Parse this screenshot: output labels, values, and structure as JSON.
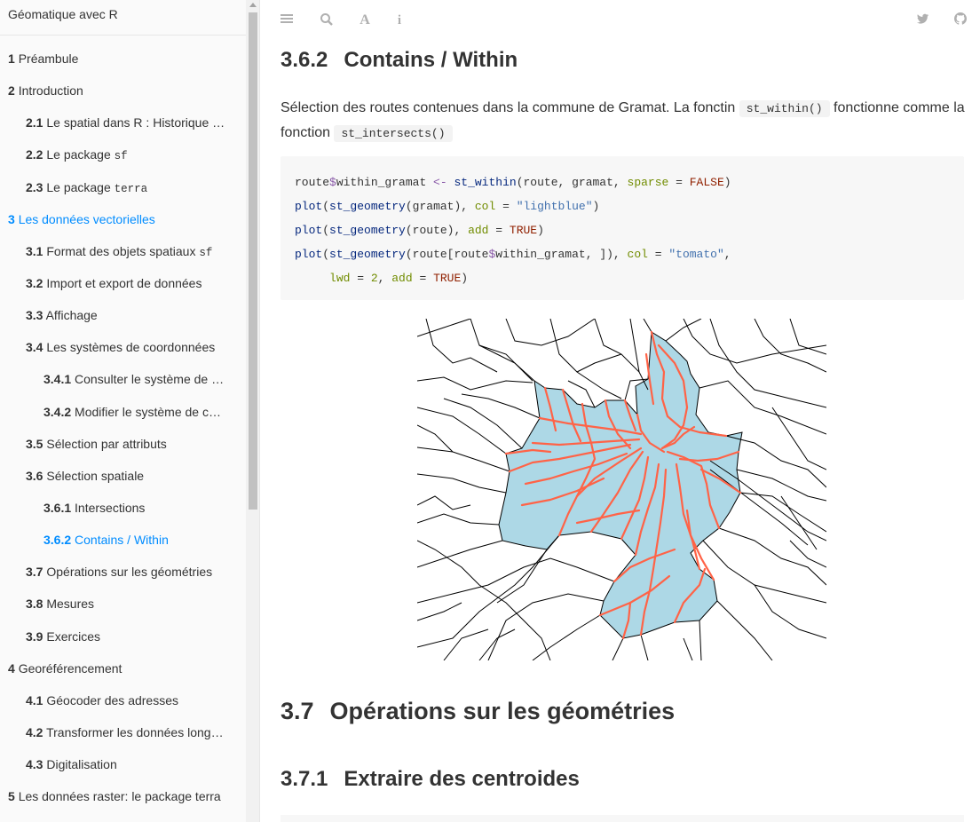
{
  "sidebar": {
    "title": "Géomatique avec R",
    "items": [
      {
        "num": "1",
        "label": "Préambule",
        "level": 1
      },
      {
        "num": "2",
        "label": "Introduction",
        "level": 1
      },
      {
        "num": "2.1",
        "label": "Le spatial dans R : Historique …",
        "level": 2
      },
      {
        "num": "2.2",
        "label": "Le package ",
        "code": "sf",
        "level": 2
      },
      {
        "num": "2.3",
        "label": "Le package ",
        "code": "terra",
        "level": 2
      },
      {
        "num": "3",
        "label": "Les données vectorielles",
        "level": 1,
        "active": true
      },
      {
        "num": "3.1",
        "label": "Format des objets spatiaux ",
        "code": "sf",
        "level": 2
      },
      {
        "num": "3.2",
        "label": "Import et export de données",
        "level": 2
      },
      {
        "num": "3.3",
        "label": "Affichage",
        "level": 2
      },
      {
        "num": "3.4",
        "label": "Les systèmes de coordonnées",
        "level": 2
      },
      {
        "num": "3.4.1",
        "label": "Consulter le système de …",
        "level": 3
      },
      {
        "num": "3.4.2",
        "label": "Modifier le système de c…",
        "level": 3
      },
      {
        "num": "3.5",
        "label": "Sélection par attributs",
        "level": 2
      },
      {
        "num": "3.6",
        "label": "Sélection spatiale",
        "level": 2
      },
      {
        "num": "3.6.1",
        "label": "Intersections",
        "level": 3
      },
      {
        "num": "3.6.2",
        "label": "Contains / Within",
        "level": 3,
        "active": true
      },
      {
        "num": "3.7",
        "label": "Opérations sur les géométries",
        "level": 2
      },
      {
        "num": "3.8",
        "label": "Mesures",
        "level": 2
      },
      {
        "num": "3.9",
        "label": "Exercices",
        "level": 2
      },
      {
        "num": "4",
        "label": "Georéférencement",
        "level": 1
      },
      {
        "num": "4.1",
        "label": "Géocoder des adresses",
        "level": 2
      },
      {
        "num": "4.2",
        "label": "Transformer les données long…",
        "level": 2
      },
      {
        "num": "4.3",
        "label": "Digitalisation",
        "level": 2
      },
      {
        "num": "5",
        "label": "Les données raster: le package terra",
        "level": 1
      }
    ]
  },
  "header": {
    "icons": [
      "menu-icon",
      "search-icon",
      "font-icon",
      "info-icon",
      "twitter-icon",
      "github-icon"
    ]
  },
  "main": {
    "section_362": {
      "num": "3.6.2",
      "title": "Contains / Within"
    },
    "paragraph": {
      "text1": "Sélection des routes contenues dans la commune de Gramat. La fonctin ",
      "code1": "st_within()",
      "text2": " fonctionne comme la fonction ",
      "code2": "st_intersects()"
    },
    "code_lines": [
      "route$within_gramat <- st_within(route, gramat, sparse = FALSE)",
      "plot(st_geometry(gramat), col = \"lightblue\")",
      "plot(st_geometry(route), add = TRUE)",
      "plot(st_geometry(route[route$within_gramat, ]), col = \"tomato\",",
      "     lwd = 2, add = TRUE)"
    ],
    "section_37": {
      "num": "3.7",
      "title": "Opérations sur les géométries"
    },
    "section_371": {
      "num": "3.7.1",
      "title": "Extraire des centroides"
    }
  },
  "colors": {
    "accent": "#008cff",
    "lightblue": "#add8e6",
    "tomato": "#ff6347"
  }
}
